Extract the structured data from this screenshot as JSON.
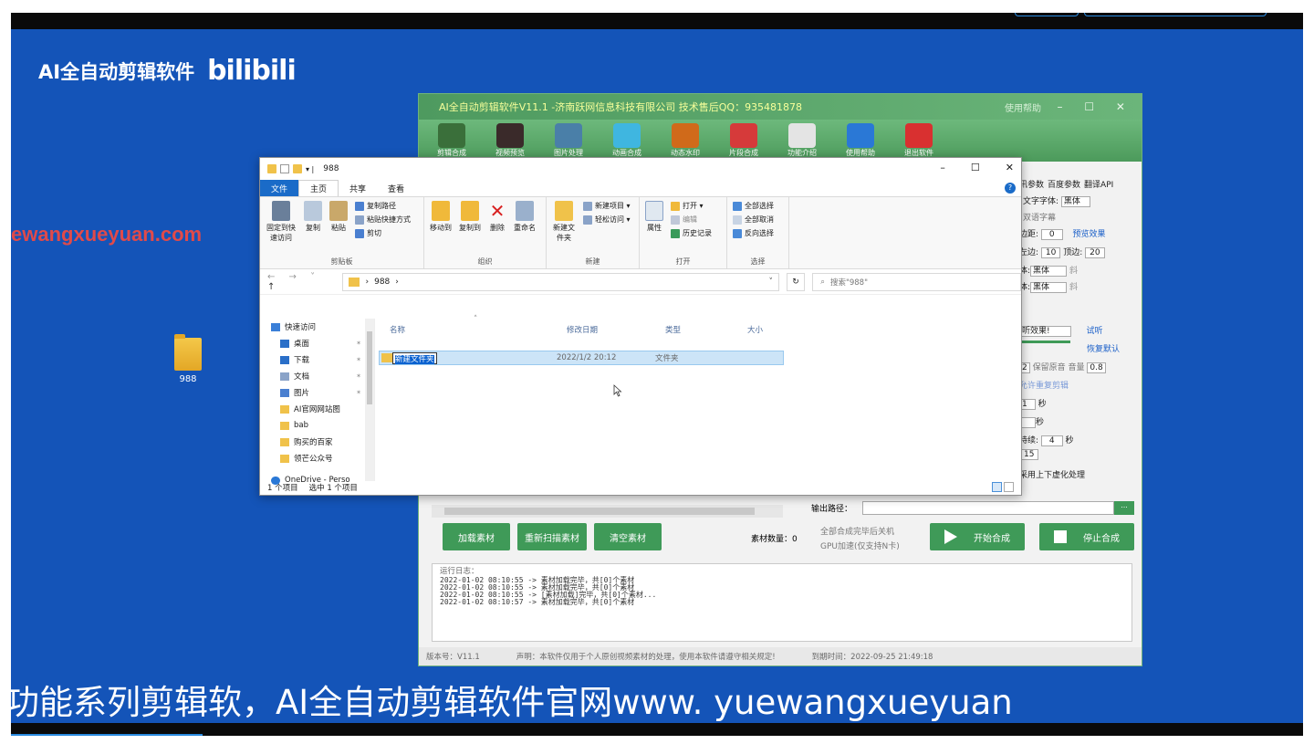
{
  "brand": {
    "title": "AI全自动剪辑软件",
    "logo": "bilibili"
  },
  "watermark": "ewangxueyuan.com",
  "desktop_folder": {
    "label": "988"
  },
  "app": {
    "title": "AI全自动剪辑软件V11.1 -济南跃网信息科技有限公司 技术售后QQ：935481878",
    "help": "使用帮助",
    "toolbar": [
      {
        "icon": "clapper-icon",
        "label": "剪辑合成",
        "color": "#3a6f3a"
      },
      {
        "icon": "film-reel-icon",
        "label": "视频预览",
        "color": "#3a2a2a"
      },
      {
        "icon": "image-edit-icon",
        "label": "图片处理",
        "color": "#4a7fa8"
      },
      {
        "icon": "video-play-icon",
        "label": "动画合成",
        "color": "#3fb6e0"
      },
      {
        "icon": "landscape-icon",
        "label": "动态水印",
        "color": "#d06a1a"
      },
      {
        "icon": "doc-icon",
        "label": "片段合成",
        "color": "#d63a3a"
      },
      {
        "icon": "home-icon",
        "label": "功能介绍",
        "color": "#e4e4e4"
      },
      {
        "icon": "help-icon",
        "label": "使用帮助",
        "color": "#2a78d6"
      },
      {
        "icon": "exit-icon",
        "label": "退出软件",
        "color": "#d93030"
      }
    ],
    "right_tabs": [
      "讯参数",
      "百度参数",
      "翻译API"
    ],
    "right_panel": {
      "font_label": "文字字体:",
      "font_value": "黑体",
      "bilingual": "双语字幕",
      "spacing_label": "边距:",
      "spacing_value": "0",
      "preview": "预览效果",
      "left_label": "左边:",
      "left_value": "10",
      "top_label": "顶边:",
      "top_value": "20",
      "font2_label": "体:",
      "font2_value": "黑体",
      "italic": "斜",
      "font3_label": "体:",
      "font3_value": "黑体",
      "italic2": "斜",
      "effect_value": "听效果!",
      "trial": "试听",
      "restore": "恢复默认",
      "keep_audio": "保留原音",
      "volume_label": "音量",
      "volume_value": "0.8",
      "num2": "2",
      "allow_repeat": "允许重复剪辑",
      "sec1": "1",
      "sec_unit": "秒",
      "sec2": "秒",
      "duration_label": "持续:",
      "duration_value": "4",
      "sec3": "秒",
      "n15": "15",
      "blur": "采用上下虚化处理"
    },
    "buttons": {
      "add": "加载素材",
      "rescan": "重新扫描素材",
      "clear": "清空素材",
      "start": "开始合成",
      "stop": "停止合成"
    },
    "output_label": "输出路径：",
    "output_btn": "...",
    "material_count": "素材数量：0",
    "shutdown": "全部合成完毕后关机",
    "gpu": "GPU加速(仅支持N卡)",
    "log": {
      "title": "运行日志：",
      "lines": [
        "2022-01-02 08:10:55 -> 素材加载完毕，共[0]个素材",
        "2022-01-02 08:10:55 -> 素材加载完毕，共[0]个素材",
        "2022-01-02 08:10:55 -> [素材加载]完毕，共[0]个素材...",
        "2022-01-02 08:10:57 -> 素材加载完毕，共[0]个素材"
      ]
    },
    "status": {
      "version": "版本号：V11.1",
      "notice": "声明：本软件仅用于个人原创视频素材的处理，使用本软件请遵守相关规定!",
      "expire": "到期时间：2022-09-25 21:49:18"
    }
  },
  "explorer": {
    "title": "988",
    "controls": [
      "–",
      "☐",
      "✕"
    ],
    "tabs": [
      "文件",
      "主页",
      "共享",
      "查看"
    ],
    "ribbon": {
      "clipboard": {
        "name": "剪贴板",
        "pin": "固定到快速访问",
        "copy": "复制",
        "paste": "粘贴",
        "copy_path": "复制路径",
        "paste_shortcut": "粘贴快捷方式",
        "cut": "剪切"
      },
      "organize": {
        "name": "组织",
        "move": "移动到",
        "copy_to": "复制到",
        "delete": "删除",
        "rename": "重命名"
      },
      "new": {
        "name": "新建",
        "new_folder": "新建文件夹",
        "new_item": "新建项目 ▾",
        "easy_access": "轻松访问 ▾"
      },
      "open": {
        "name": "打开",
        "props": "属性",
        "open": "打开 ▾",
        "edit": "编辑",
        "history": "历史记录"
      },
      "select": {
        "name": "选择",
        "all": "全部选择",
        "none": "全部取消",
        "invert": "反向选择"
      }
    },
    "address": {
      "path": "988",
      "search_placeholder": "搜索\"988\""
    },
    "nav": [
      {
        "label": "快速访问",
        "icon": "star-icon",
        "head": true
      },
      {
        "label": "桌面",
        "icon": "desktop-icon",
        "pin": true
      },
      {
        "label": "下载",
        "icon": "download-icon",
        "pin": true
      },
      {
        "label": "文档",
        "icon": "document-icon",
        "pin": true
      },
      {
        "label": "图片",
        "icon": "picture-icon",
        "pin": true
      },
      {
        "label": "AI官网网站图",
        "icon": "folder-icon"
      },
      {
        "label": "bab",
        "icon": "folder-icon"
      },
      {
        "label": "购买的百家",
        "icon": "folder-icon"
      },
      {
        "label": "领芒公众号",
        "icon": "folder-icon"
      },
      {
        "label": "OneDrive - Perso",
        "icon": "cloud-icon",
        "head": true
      }
    ],
    "columns": {
      "name": "名称",
      "date": "修改日期",
      "type": "类型",
      "size": "大小"
    },
    "files": [
      {
        "name": "新建文件夹",
        "date": "2022/1/2 20:12",
        "type": "文件夹"
      }
    ],
    "status": {
      "count": "1 个项目",
      "selected": "选中 1 个项目"
    }
  },
  "subtitle": "功能系列剪辑软，AI全自动剪辑软件官网www. yuewangxueyuan"
}
